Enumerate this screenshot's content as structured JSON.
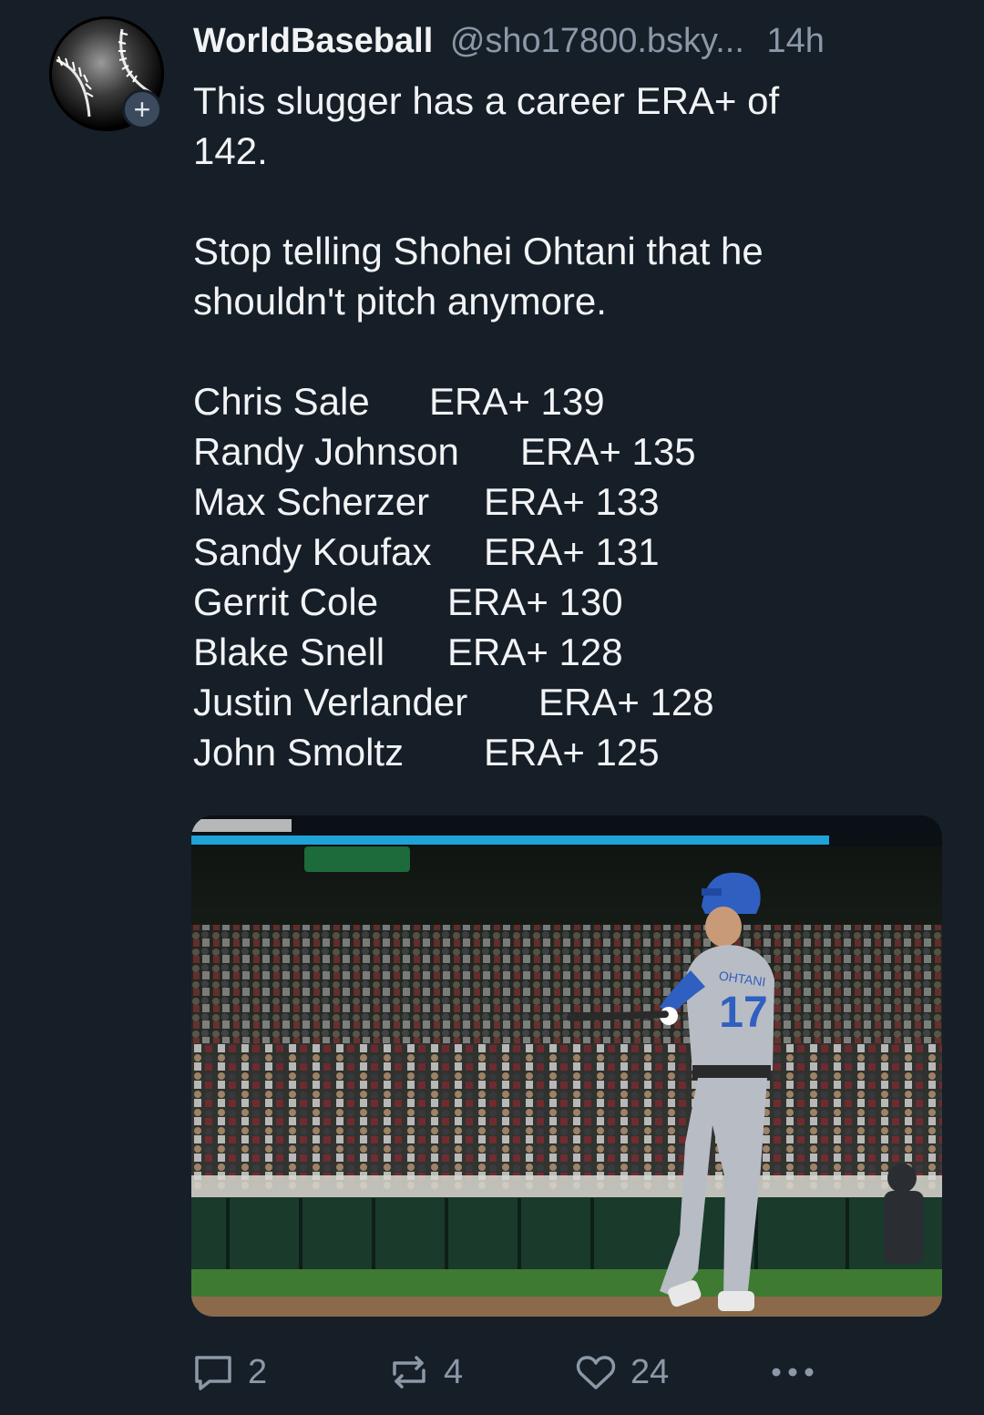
{
  "post": {
    "author": {
      "display_name": "WorldBaseball",
      "handle": "@sho17800.bsky...",
      "avatar_icon": "baseball-icon",
      "follow_label": "+"
    },
    "timestamp": "14h",
    "text": {
      "intro_line1": "This slugger has a career ERA+ of",
      "intro_line2": "142.",
      "paragraph2_line1": "Stop telling Shohei Ohtani that he",
      "paragraph2_line2": "shouldn't pitch anymore."
    },
    "era_list": [
      {
        "name": "Chris Sale",
        "stat": "ERA+ 139"
      },
      {
        "name": "Randy Johnson",
        "stat": "ERA+ 135"
      },
      {
        "name": "Max Scherzer",
        "stat": "ERA+ 133"
      },
      {
        "name": "Sandy Koufax",
        "stat": "ERA+ 131"
      },
      {
        "name": "Gerrit Cole",
        "stat": "ERA+ 130"
      },
      {
        "name": "Blake Snell",
        "stat": "ERA+ 128"
      },
      {
        "name": "Justin Verlander",
        "stat": "ERA+ 128"
      },
      {
        "name": "John Smoltz",
        "stat": "ERA+ 125"
      }
    ],
    "image": {
      "jersey_name": "OHTANI",
      "jersey_number": "17"
    },
    "actions": {
      "reply_count": "2",
      "repost_count": "4",
      "like_count": "24",
      "reply_icon": "speech-bubble-icon",
      "repost_icon": "repost-arrows-icon",
      "like_icon": "heart-icon",
      "more_icon": "ellipsis-icon"
    }
  },
  "colors": {
    "background": "#161e27",
    "text_primary": "#f1f3f5",
    "text_secondary": "#8b98a8",
    "dodgers_blue": "#2f5fc0"
  }
}
